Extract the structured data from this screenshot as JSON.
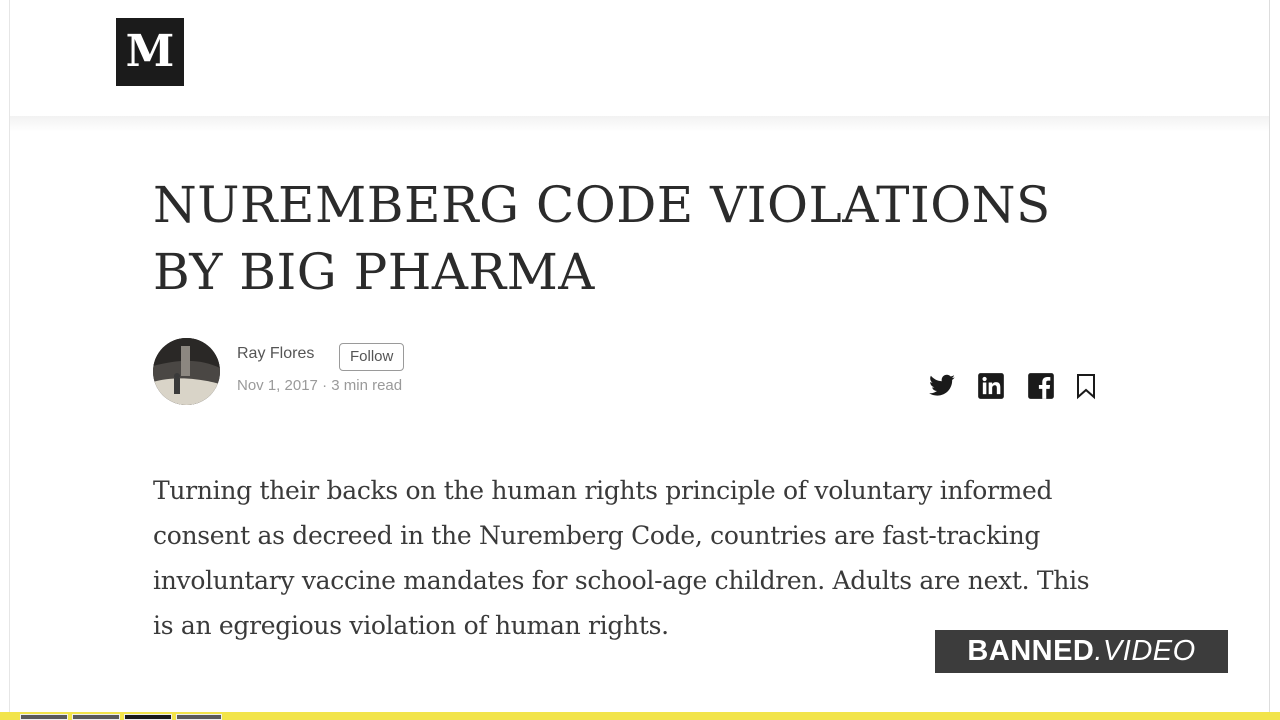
{
  "brand": {
    "logo_text": "M"
  },
  "article": {
    "title": "NUREMBERG CODE VIOLATIONS BY BIG PHARMA",
    "author": "Ray Flores",
    "follow_label": "Follow",
    "date": "Nov 1, 2017",
    "separator": "·",
    "read_time": "3 min read",
    "body": "Turning their backs on the human rights principle of voluntary informed consent as decreed in the Nuremberg Code, countries are fast-tracking involuntary vaccine mandates for school-age children. Adults are next. This is an egregious violation of human rights."
  },
  "share_icons": [
    "twitter-icon",
    "linkedin-icon",
    "facebook-icon",
    "bookmark-icon"
  ],
  "watermark": {
    "part1": "BANNED",
    "part2": ".VIDEO"
  },
  "colors": {
    "title": "#2b2b2b",
    "body": "#3a3a3a",
    "meta": "#9a9a9a",
    "watermark_bg": "#3c3c3c",
    "bottom_strip": "#f2e44a"
  }
}
